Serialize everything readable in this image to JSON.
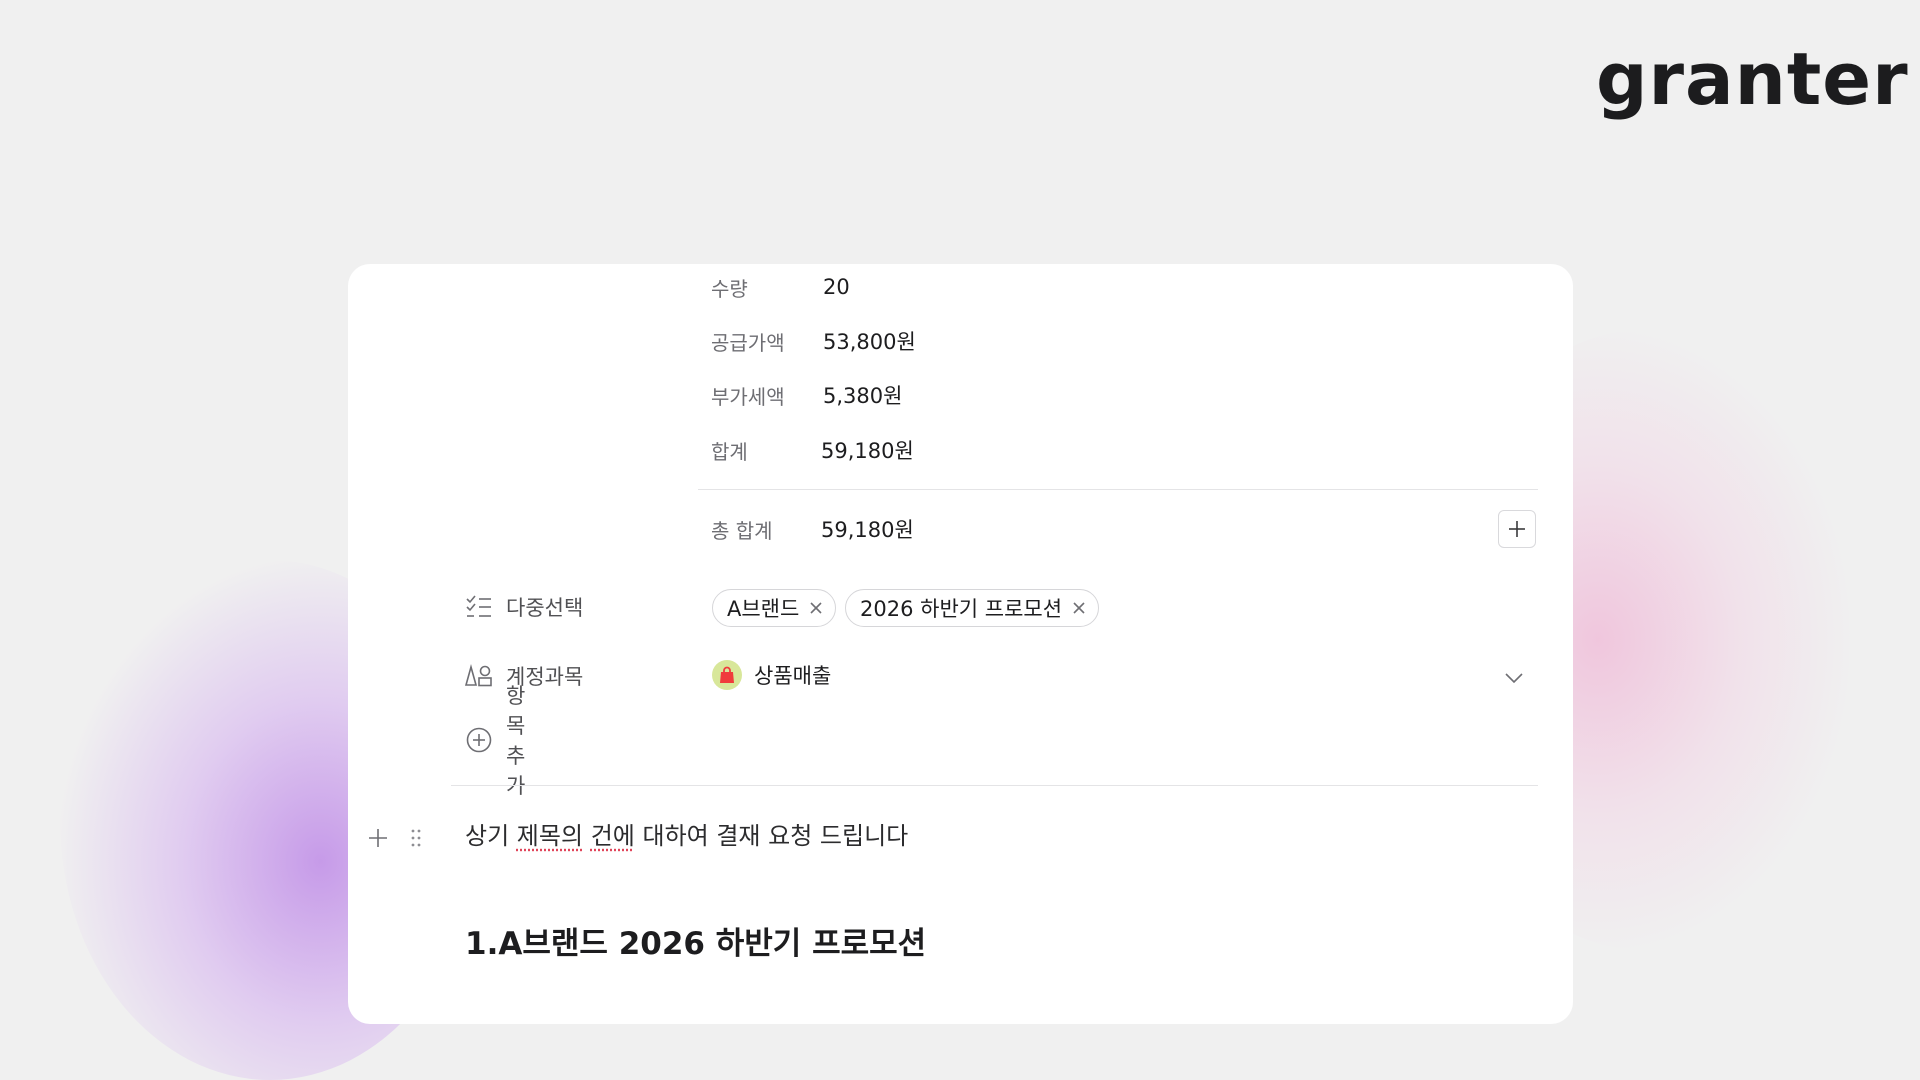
{
  "brand": {
    "logo": "granter"
  },
  "summary": {
    "rows": [
      {
        "label": "수량",
        "value": "20"
      },
      {
        "label": "공급가액",
        "value": "53,800원"
      },
      {
        "label": "부가세액",
        "value": "5,380원"
      },
      {
        "label": "합계",
        "value": "59,180원"
      }
    ],
    "total_label": "총 합계",
    "total_value": "59,180원"
  },
  "properties": {
    "multi_select": {
      "label": "다중선택",
      "icon": "checklist-icon",
      "tags": [
        "A브랜드",
        "2026 하반기 프로모션"
      ]
    },
    "account": {
      "label": "계정과목",
      "icon": "shapes-icon",
      "value": "상품매출",
      "value_icon": "shopping-bag-icon",
      "value_icon_bg": "#d8e79a",
      "value_icon_color": "#f03c3c"
    },
    "add_item": {
      "label": "항목 추가",
      "icon": "plus-circle-icon"
    }
  },
  "document": {
    "body_text": {
      "p1": "상기 ",
      "p2": "제목의",
      "p3": " ",
      "p4": "건에",
      "p5": " 대하여 결재 요청 드립니다"
    },
    "heading": "1.A브랜드 2026 하반기 프로모션"
  },
  "colors": {
    "background": "#f0f0f0",
    "card": "#ffffff",
    "glow_left": "#c496e8",
    "glow_right": "#f0c4dc"
  }
}
